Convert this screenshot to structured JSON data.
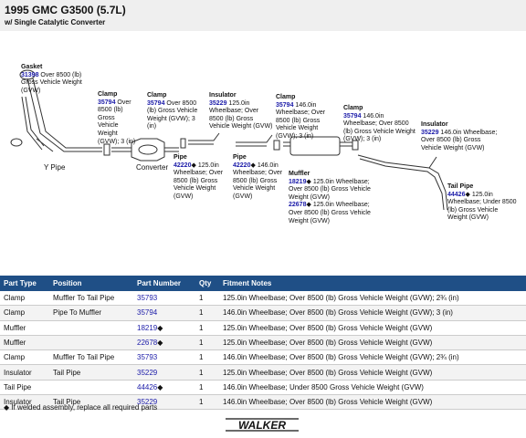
{
  "header": {
    "title": "1995 GMC G3500 (5.7L)",
    "subtitle": "w/ Single Catalytic Converter"
  },
  "diagram": {
    "callouts": [
      {
        "name": "gasket-callout",
        "title": "Gasket",
        "part": "31398",
        "diamond": "",
        "desc": "Over 8500 (lb) Gross Vehicle Weight (GVW)"
      },
      {
        "name": "clamp-callout-1",
        "title": "Clamp",
        "part": "35794",
        "diamond": "",
        "desc": "Over 8500 (lb) Gross Vehicle Weight (GVW); 3 (in)"
      },
      {
        "name": "clamp-callout-2",
        "title": "Clamp",
        "part": "35794",
        "diamond": "",
        "desc": "Over 8500 (lb) Gross Vehicle Weight (GVW); 3 (in)"
      },
      {
        "name": "insulator-callout-1",
        "title": "Insulator",
        "part": "35229",
        "diamond": "",
        "desc": "125.0in Wheelbase; Over 8500 (lb) Gross Vehicle Weight (GVW)"
      },
      {
        "name": "clamp-callout-3",
        "title": "Clamp",
        "part": "35794",
        "diamond": "",
        "desc": "146.0in Wheelbase; Over 8500 (lb) Gross Vehicle Weight (GVW); 3 (in)"
      },
      {
        "name": "clamp-callout-4",
        "title": "Clamp",
        "part": "35794",
        "diamond": "",
        "desc": "146.0in Wheelbase; Over 8500 (lb) Gross Vehicle Weight (GVW); 3 (in)"
      },
      {
        "name": "insulator-callout-2",
        "title": "Insulator",
        "part": "35229",
        "diamond": "",
        "desc": "146.0in Wheelbase; Over 8500 (lb) Gross Vehicle Weight (GVW)"
      },
      {
        "name": "pipe-callout-1",
        "title": "Pipe",
        "part": "42220",
        "diamond": "◆",
        "desc": "125.0in Wheelbase; Over 8500 (lb) Gross Vehicle Weight (GVW)"
      },
      {
        "name": "pipe-callout-2",
        "title": "Pipe",
        "part": "42220",
        "diamond": "◆",
        "desc": "146.0in Wheelbase; Over 8500 (lb) Gross Vehicle Weight (GVW)"
      },
      {
        "name": "muffler-callout",
        "title": "Muffler",
        "part": "18219",
        "diamond": "◆",
        "desc": "125.0in Wheelbase; Over 8500 (lb) Gross Vehicle Weight (GVW)",
        "part2": "22678",
        "diamond2": "◆",
        "desc2": "125.0in Wheelbase; Over 8500 (lb) Gross Vehicle Weight (GVW)"
      },
      {
        "name": "tailpipe-callout",
        "title": "Tail Pipe",
        "part": "44426",
        "diamond": "◆",
        "desc": "125.0in Wheelbase; Under 8500 (lb) Gross Vehicle Weight (GVW)"
      }
    ],
    "captions": {
      "y_pipe": "Y Pipe",
      "converter": "Converter"
    }
  },
  "table": {
    "headers": [
      "Part Type",
      "Position",
      "Part Number",
      "Qty",
      "Fitment Notes"
    ],
    "rows": [
      {
        "type": "Clamp",
        "position": "Muffler To Tail Pipe",
        "part": "35793",
        "mark": "",
        "qty": "1",
        "notes": "125.0in Wheelbase; Over 8500 (lb) Gross Vehicle Weight (GVW); 2¾ (in)"
      },
      {
        "type": "Clamp",
        "position": "Pipe To Muffler",
        "part": "35794",
        "mark": "",
        "qty": "1",
        "notes": "146.0in Wheelbase; Over 8500 (lb) Gross Vehicle Weight (GVW); 3 (in)"
      },
      {
        "type": "Muffler",
        "position": "",
        "part": "18219",
        "mark": "◆",
        "qty": "1",
        "notes": "125.0in Wheelbase; Over 8500 (lb) Gross Vehicle Weight (GVW)"
      },
      {
        "type": "Muffler",
        "position": "",
        "part": "22678",
        "mark": "◆",
        "qty": "1",
        "notes": "125.0in Wheelbase; Over 8500 (lb) Gross Vehicle Weight (GVW)"
      },
      {
        "type": "Clamp",
        "position": "Muffler To Tail Pipe",
        "part": "35793",
        "mark": "",
        "qty": "1",
        "notes": "146.0in Wheelbase; Over 8500 (lb) Gross Vehicle Weight (GVW); 2¾ (in)"
      },
      {
        "type": "Insulator",
        "position": "Tail Pipe",
        "part": "35229",
        "mark": "",
        "qty": "1",
        "notes": "125.0in Wheelbase; Over 8500 (lb) Gross Vehicle Weight (GVW)"
      },
      {
        "type": "Tail Pipe",
        "position": "",
        "part": "44426",
        "mark": "◆",
        "qty": "1",
        "notes": "146.0in Wheelbase; Under 8500 Gross Vehicle Weight (GVW)"
      },
      {
        "type": "Insulator",
        "position": "Tail Pipe",
        "part": "35229",
        "mark": "",
        "qty": "1",
        "notes": "146.0in Wheelbase; Over 8500 (lb) Gross Vehicle Weight (GVW)"
      }
    ]
  },
  "footer": {
    "note": "◆ If welded assembly, replace all required parts"
  },
  "logo": {
    "text": "WALKER"
  },
  "colors": {
    "table_header": "#1f4f86",
    "part_link": "#1a1aa8"
  }
}
